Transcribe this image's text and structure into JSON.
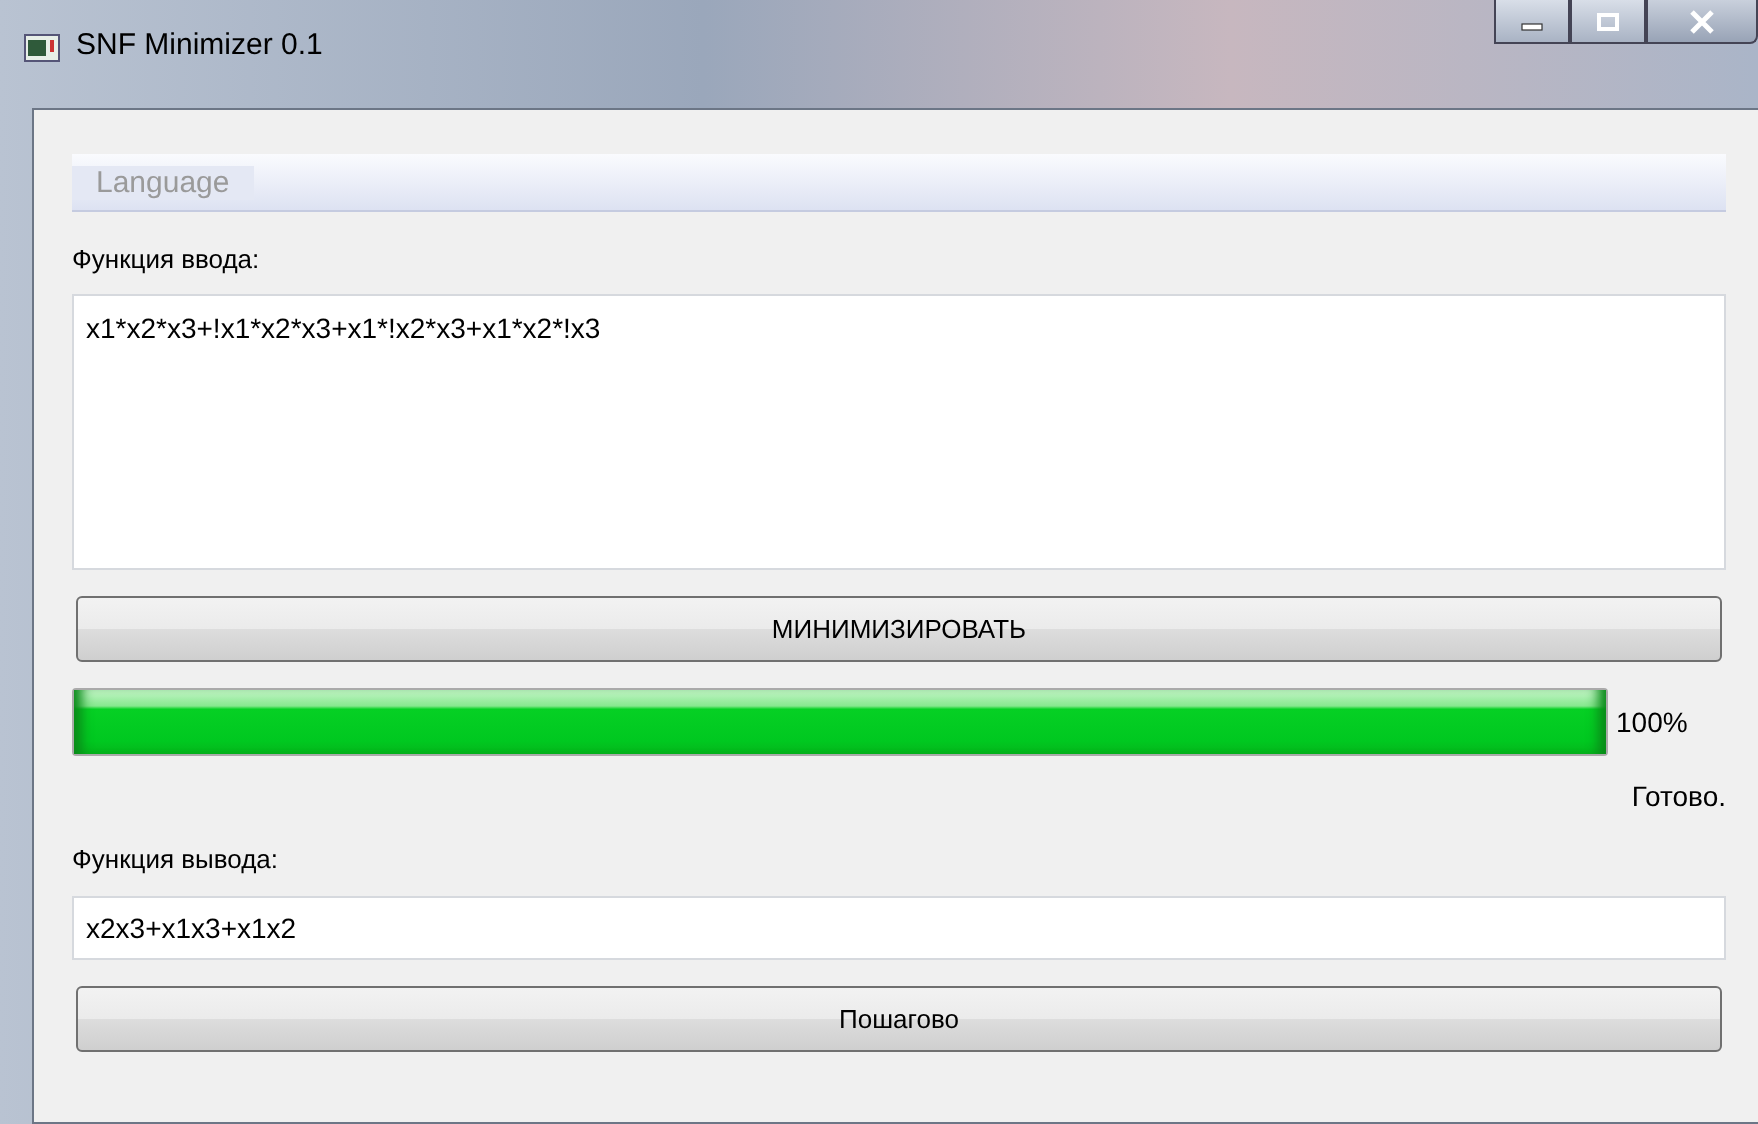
{
  "window": {
    "title": "SNF Minimizer 0.1"
  },
  "menu_bar": {
    "items": [
      "Language"
    ]
  },
  "input": {
    "label": "Функция ввода:",
    "value": "x1*x2*x3+!x1*x2*x3+x1*!x2*x3+x1*x2*!x3"
  },
  "minimize_button": "МИНИМИЗИРОВАТЬ",
  "progress": {
    "level": 1,
    "reading": "100%"
  },
  "status": "Готово.",
  "output": {
    "label": "Функция вывода:",
    "value": "x2x3+x1x3+x1x2"
  },
  "step_button": "Пошагово"
}
